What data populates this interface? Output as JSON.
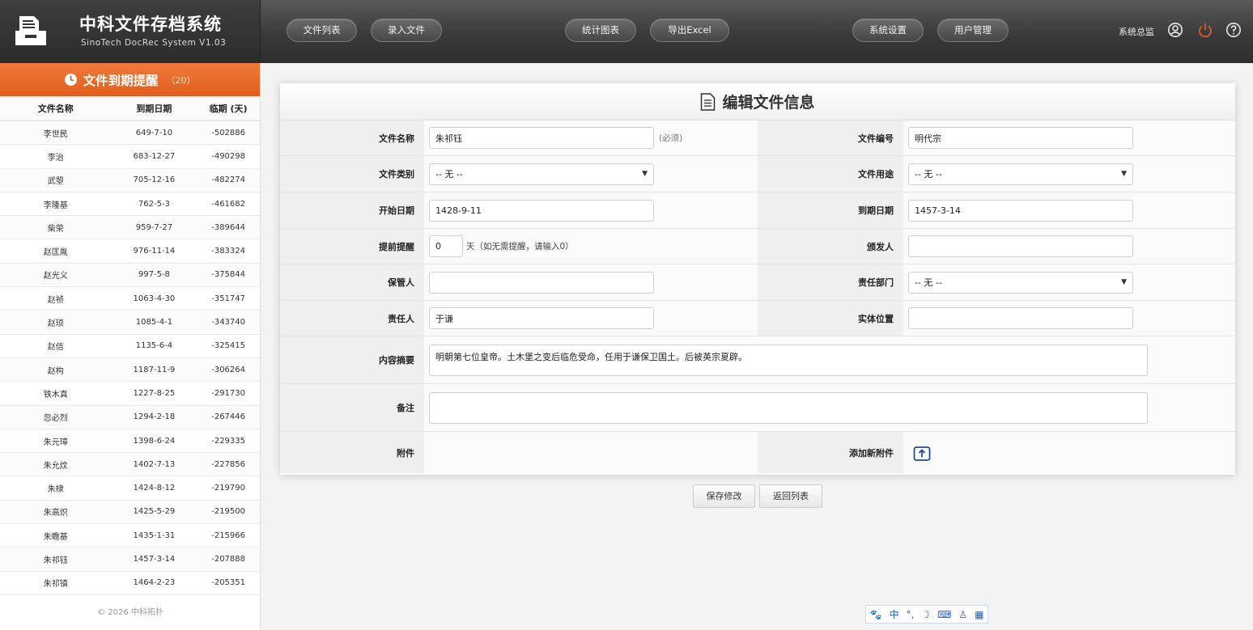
{
  "app": {
    "title": "中科文件存档系统",
    "subtitle": "SinoTech DocRec System V1.03",
    "user": "系统总监"
  },
  "nav": {
    "file_list": "文件列表",
    "add_file": "录入文件",
    "stats": "统计图表",
    "export": "导出Excel",
    "settings": "系统设置",
    "users": "用户管理"
  },
  "reminder": {
    "title": "文件到期提醒",
    "count": "（20）",
    "columns": [
      "文件名称",
      "到期日期",
      "临期 (天)"
    ],
    "rows": [
      [
        "李世民",
        "649-7-10",
        "-502886"
      ],
      [
        "李治",
        "683-12-27",
        "-490298"
      ],
      [
        "武曌",
        "705-12-16",
        "-482274"
      ],
      [
        "李隆基",
        "762-5-3",
        "-461682"
      ],
      [
        "柴荣",
        "959-7-27",
        "-389644"
      ],
      [
        "赵匡胤",
        "976-11-14",
        "-383324"
      ],
      [
        "赵光义",
        "997-5-8",
        "-375844"
      ],
      [
        "赵祯",
        "1063-4-30",
        "-351747"
      ],
      [
        "赵顼",
        "1085-4-1",
        "-343740"
      ],
      [
        "赵佶",
        "1135-6-4",
        "-325415"
      ],
      [
        "赵构",
        "1187-11-9",
        "-306264"
      ],
      [
        "铁木真",
        "1227-8-25",
        "-291730"
      ],
      [
        "忽必烈",
        "1294-2-18",
        "-267446"
      ],
      [
        "朱元璋",
        "1398-6-24",
        "-229335"
      ],
      [
        "朱允炆",
        "1402-7-13",
        "-227856"
      ],
      [
        "朱棣",
        "1424-8-12",
        "-219790"
      ],
      [
        "朱高炽",
        "1425-5-29",
        "-219500"
      ],
      [
        "朱瞻基",
        "1435-1-31",
        "-215966"
      ],
      [
        "朱祁钰",
        "1457-3-14",
        "-207888"
      ],
      [
        "朱祁镇",
        "1464-2-23",
        "-205351"
      ]
    ]
  },
  "copyright": "© 2026 中科拓扑",
  "form": {
    "title": "编辑文件信息",
    "labels": {
      "name": "文件名称",
      "number": "文件编号",
      "category": "文件类别",
      "usage": "文件用途",
      "start_date": "开始日期",
      "end_date": "到期日期",
      "remind": "提前提醒",
      "issuer": "颁发人",
      "keeper": "保管人",
      "department": "责任部门",
      "owner": "责任人",
      "location": "实体位置",
      "summary": "内容摘要",
      "remark": "备注",
      "attachment": "附件",
      "add_attachment": "添加新附件"
    },
    "values": {
      "name": "朱祁钰",
      "name_hint": "(必须)",
      "number": "明代宗",
      "category": "-- 无 --",
      "usage": "-- 无 --",
      "start_date": "1428-9-11",
      "end_date": "1457-3-14",
      "remind": "0",
      "remind_hint": "天（如无需提醒，请输入0）",
      "issuer": "",
      "keeper": "",
      "department": "-- 无 --",
      "owner": "于谦",
      "location": "",
      "summary": "明朝第七位皇帝。土木堡之变后临危受命，任用于谦保卫国土。后被英宗夏辟。",
      "remark": ""
    },
    "save_button": "保存修改",
    "back_button": "返回列表"
  },
  "ime": {
    "lang": "中"
  }
}
